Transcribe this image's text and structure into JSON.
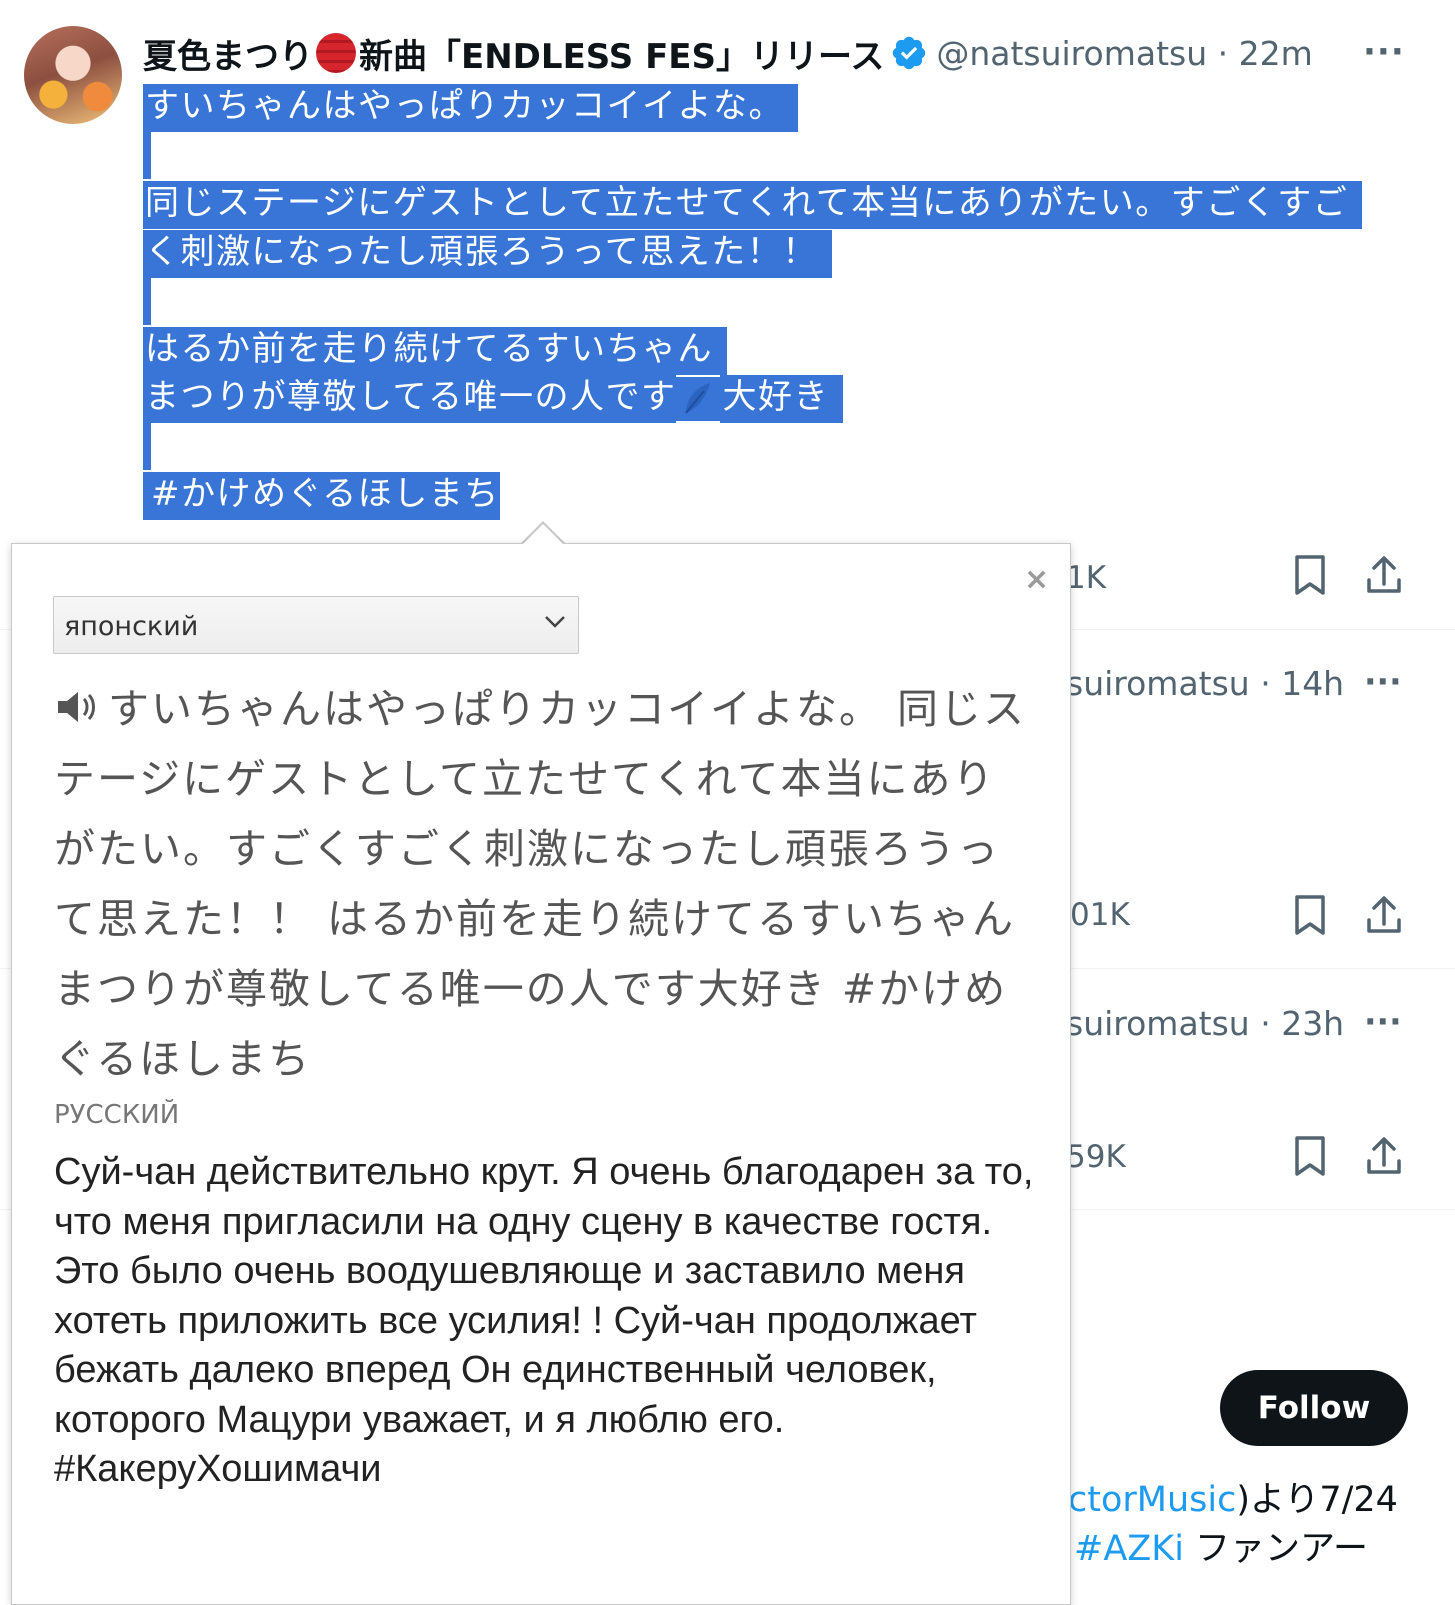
{
  "tweet": {
    "display_name": "夏色まつり",
    "display_name_suffix": "新曲「ENDLESS FES」リリース",
    "handle": "@natsuiromatsu",
    "time": "22m",
    "more": "···",
    "lines": {
      "l1": "すいちゃんはやっぱりカッコイイよな。",
      "l3": "同じステージにゲストとして立たせてくれて本当にありがたい。すごくすご",
      "l4": "く刺激になったし頑張ろうって思えた！！",
      "l6": "はるか前を走り続けてるすいちゃん",
      "l7a": "まつりが尊敬してる唯一の人です",
      "l7b": "大好き",
      "l9": "#かけめぐるほしまち"
    }
  },
  "feed": {
    "row1_count": "1K",
    "row2_handle": "suiromatsu · 14h",
    "row2_more": "···",
    "row2_count": "01K",
    "row3_handle": "suiromatsu · 23h",
    "row3_more": "···",
    "row3_count": "59K",
    "follow_label": "Follow",
    "bottom_line1_link": "ctorMusic",
    "bottom_line1_rest": ")より7/24",
    "bottom_line2_link": "#AZKi",
    "bottom_line2_rest": " ファンアー"
  },
  "translator": {
    "close_label": "×",
    "source_language": "японский",
    "source_text": "すいちゃんはやっぱりカッコイイよな。 同じステージにゲストとして立たせてくれて本当にありがたい。すごくすごく刺激になったし頑張ろうって思えた！！ はるか前を走り続けてるすいちゃん まつりが尊敬してる唯一の人です大好き #かけめぐるほしまち",
    "target_language": "РУССКИЙ",
    "target_text": "Суй-чан действительно крут. Я очень благодарен за то, что меня пригласили на одну сцену в качестве гостя. Это было очень воодушевляюще и заставило меня хотеть приложить все усилия! ! Суй-чан продолжает бежать далеко вперед Он единственный человек, которого Мацури уважает, и я люблю его. #КакеруХошимачи"
  },
  "colors": {
    "selection": "#3875d7",
    "verified": "#1d9bf0",
    "link": "#1d9bf0",
    "follow_bg": "#0f1419"
  },
  "icons": [
    "avatar",
    "lantern-flag-icon",
    "verified-badge-icon",
    "more-icon",
    "leaf-icon",
    "close-icon",
    "chevron-down-icon",
    "speaker-icon",
    "bookmark-icon",
    "share-icon"
  ]
}
